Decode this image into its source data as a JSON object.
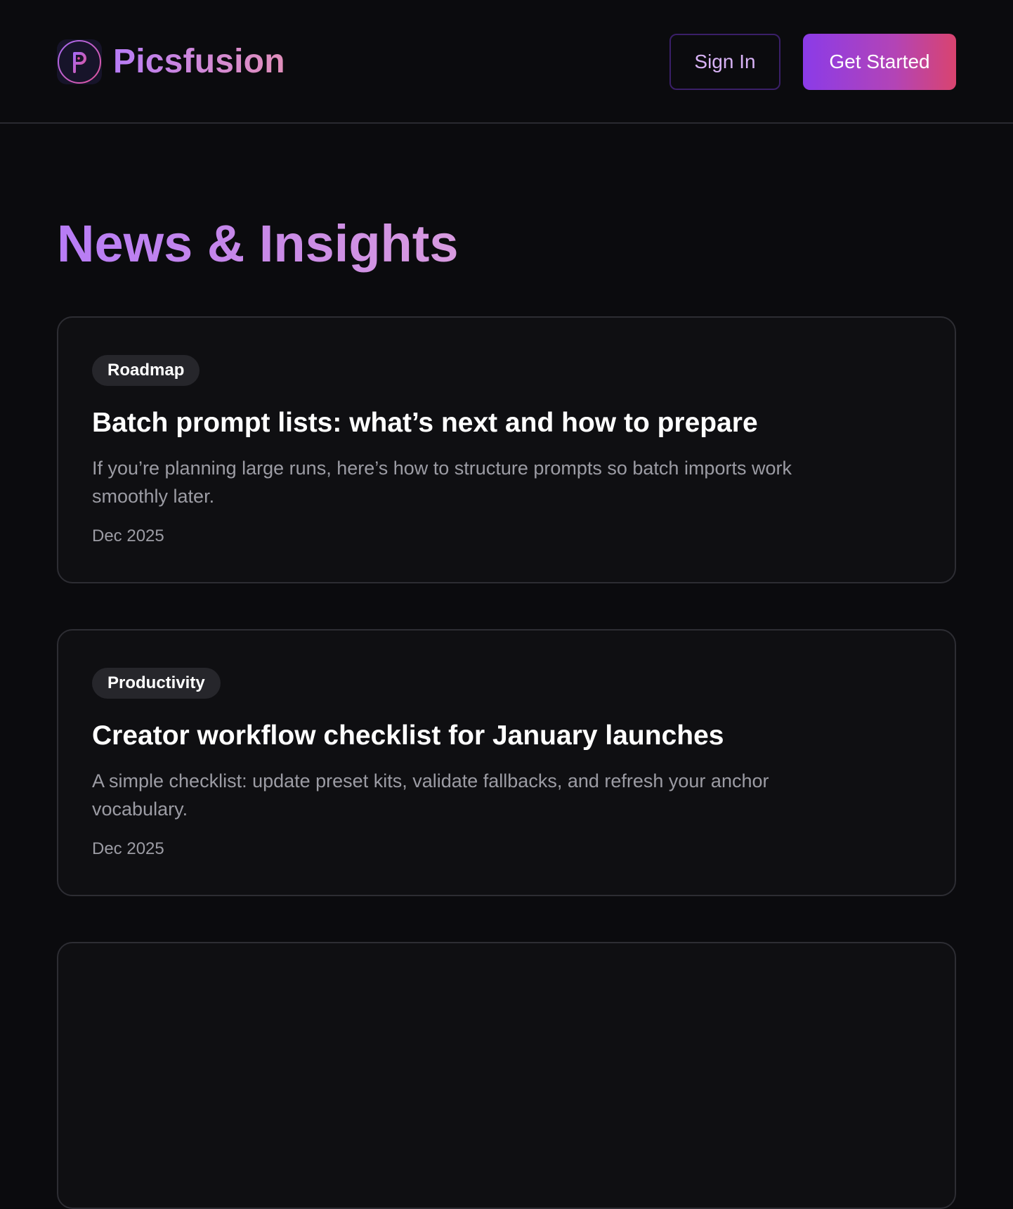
{
  "header": {
    "brand_name": "Picsfusion",
    "sign_in_label": "Sign In",
    "get_started_label": "Get Started"
  },
  "main": {
    "title": "News & Insights",
    "posts": [
      {
        "tag": "Roadmap",
        "title": "Batch prompt lists: what’s next and how to prepare",
        "excerpt": "If you’re planning large runs, here’s how to structure prompts so batch imports work smoothly later.",
        "date": "Dec 2025"
      },
      {
        "tag": "Productivity",
        "title": "Creator workflow checklist for January launches",
        "excerpt": "A simple checklist: update preset kits, validate fallbacks, and refresh your anchor vocabulary.",
        "date": "Dec 2025"
      }
    ]
  },
  "colors": {
    "background": "#0b0b0e",
    "accent_purple": "#8b3be8",
    "accent_pink": "#d9446f",
    "muted_text": "#9c9ca4"
  }
}
